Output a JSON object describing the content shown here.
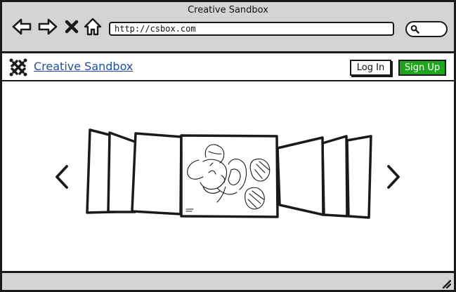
{
  "window": {
    "title": "Creative Sandbox"
  },
  "browser": {
    "url": "http://csbox.com",
    "icons": {
      "back": "arrow-left-icon",
      "forward": "arrow-right-icon",
      "stop": "close-icon",
      "home": "home-icon",
      "search": "search-icon"
    }
  },
  "header": {
    "site_name": "Creative Sandbox",
    "login_label": "Log In",
    "signup_label": "Sign Up",
    "logo_icon": "joomla-logo-icon"
  },
  "carousel": {
    "prev_icon": "chevron-left-icon",
    "next_icon": "chevron-right-icon",
    "slide_count": 7,
    "active_slide": 4,
    "active_image": "cartoon-mice-sketch"
  },
  "colors": {
    "chrome": "#d4d4d4",
    "link": "#1f4f9e",
    "signup": "#1ea51e",
    "ink": "#1a1a1a"
  }
}
